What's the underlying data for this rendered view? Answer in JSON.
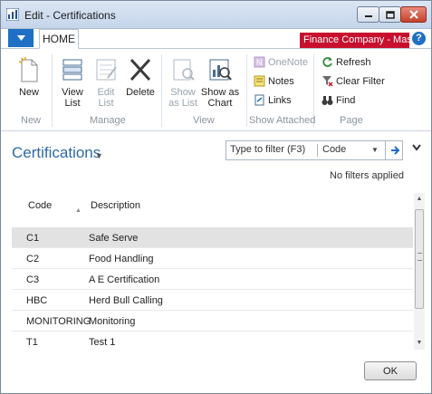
{
  "window": {
    "title": "Edit - Certifications"
  },
  "tabs": {
    "home": "HOME"
  },
  "company": "Finance Company - Mast...",
  "help": "?",
  "ribbon": {
    "new": "New",
    "view_list": [
      "View",
      "List"
    ],
    "edit_list": [
      "Edit",
      "List"
    ],
    "delete": "Delete",
    "show_as_list": [
      "Show",
      "as List"
    ],
    "show_as_chart": [
      "Show as",
      "Chart"
    ],
    "onenote": "OneNote",
    "notes": "Notes",
    "links": "Links",
    "refresh": "Refresh",
    "clear_filter": "Clear Filter",
    "find": "Find",
    "groups": {
      "new": "New",
      "manage": "Manage",
      "view": "View",
      "show_attached": "Show Attached",
      "page": "Page"
    }
  },
  "page": {
    "title": "Certifications",
    "no_filters": "No filters applied"
  },
  "filter": {
    "placeholder": "Type to filter (F3)",
    "field": "Code"
  },
  "table": {
    "headers": {
      "code": "Code",
      "description": "Description"
    },
    "rows": [
      {
        "code": "C1",
        "description": "Safe Serve",
        "selected": true
      },
      {
        "code": "C2",
        "description": "Food Handling"
      },
      {
        "code": "C3",
        "description": "A E Certification"
      },
      {
        "code": "HBC",
        "description": "Herd Bull Calling"
      },
      {
        "code": "MONITORING",
        "description": "Monitoring"
      },
      {
        "code": "T1",
        "description": "Test 1"
      }
    ]
  },
  "footer": {
    "ok": "OK"
  },
  "colors": {
    "accent": "#1f6fc5",
    "company_bg": "#c8102e",
    "title_text": "#2d6aa6"
  }
}
